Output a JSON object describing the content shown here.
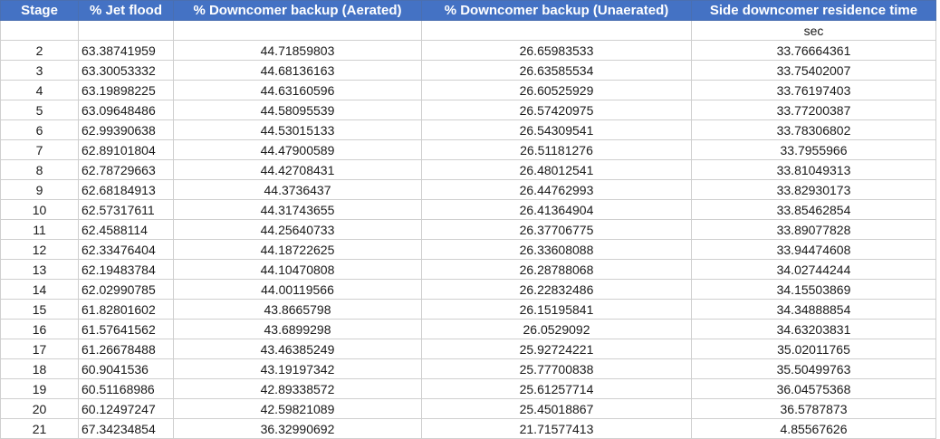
{
  "columns": [
    "Stage",
    "% Jet flood",
    "% Downcomer backup (Aerated)",
    "% Downcomer backup (Unaerated)",
    "Side downcomer residence time"
  ],
  "units": [
    "",
    "",
    "",
    "",
    "sec"
  ],
  "rows": [
    [
      "2",
      "63.38741959",
      "44.71859803",
      "26.65983533",
      "33.76664361"
    ],
    [
      "3",
      "63.30053332",
      "44.68136163",
      "26.63585534",
      "33.75402007"
    ],
    [
      "4",
      "63.19898225",
      "44.63160596",
      "26.60525929",
      "33.76197403"
    ],
    [
      "5",
      "63.09648486",
      "44.58095539",
      "26.57420975",
      "33.77200387"
    ],
    [
      "6",
      "62.99390638",
      "44.53015133",
      "26.54309541",
      "33.78306802"
    ],
    [
      "7",
      "62.89101804",
      "44.47900589",
      "26.51181276",
      "33.7955966"
    ],
    [
      "8",
      "62.78729663",
      "44.42708431",
      "26.48012541",
      "33.81049313"
    ],
    [
      "9",
      "62.68184913",
      "44.3736437",
      "26.44762993",
      "33.82930173"
    ],
    [
      "10",
      "62.57317611",
      "44.31743655",
      "26.41364904",
      "33.85462854"
    ],
    [
      "11",
      "62.4588114",
      "44.25640733",
      "26.37706775",
      "33.89077828"
    ],
    [
      "12",
      "62.33476404",
      "44.18722625",
      "26.33608088",
      "33.94474608"
    ],
    [
      "13",
      "62.19483784",
      "44.10470808",
      "26.28788068",
      "34.02744244"
    ],
    [
      "14",
      "62.02990785",
      "44.00119566",
      "26.22832486",
      "34.15503869"
    ],
    [
      "15",
      "61.82801602",
      "43.8665798",
      "26.15195841",
      "34.34888854"
    ],
    [
      "16",
      "61.57641562",
      "43.6899298",
      "26.0529092",
      "34.63203831"
    ],
    [
      "17",
      "61.26678488",
      "43.46385249",
      "25.92724221",
      "35.02011765"
    ],
    [
      "18",
      "60.9041536",
      "43.19197342",
      "25.77700838",
      "35.50499763"
    ],
    [
      "19",
      "60.51168986",
      "42.89338572",
      "25.61257714",
      "36.04575368"
    ],
    [
      "20",
      "60.12497247",
      "42.59821089",
      "25.45018867",
      "36.5787873"
    ],
    [
      "21",
      "67.34234854",
      "36.32990692",
      "21.71577413",
      "4.85567626"
    ]
  ]
}
